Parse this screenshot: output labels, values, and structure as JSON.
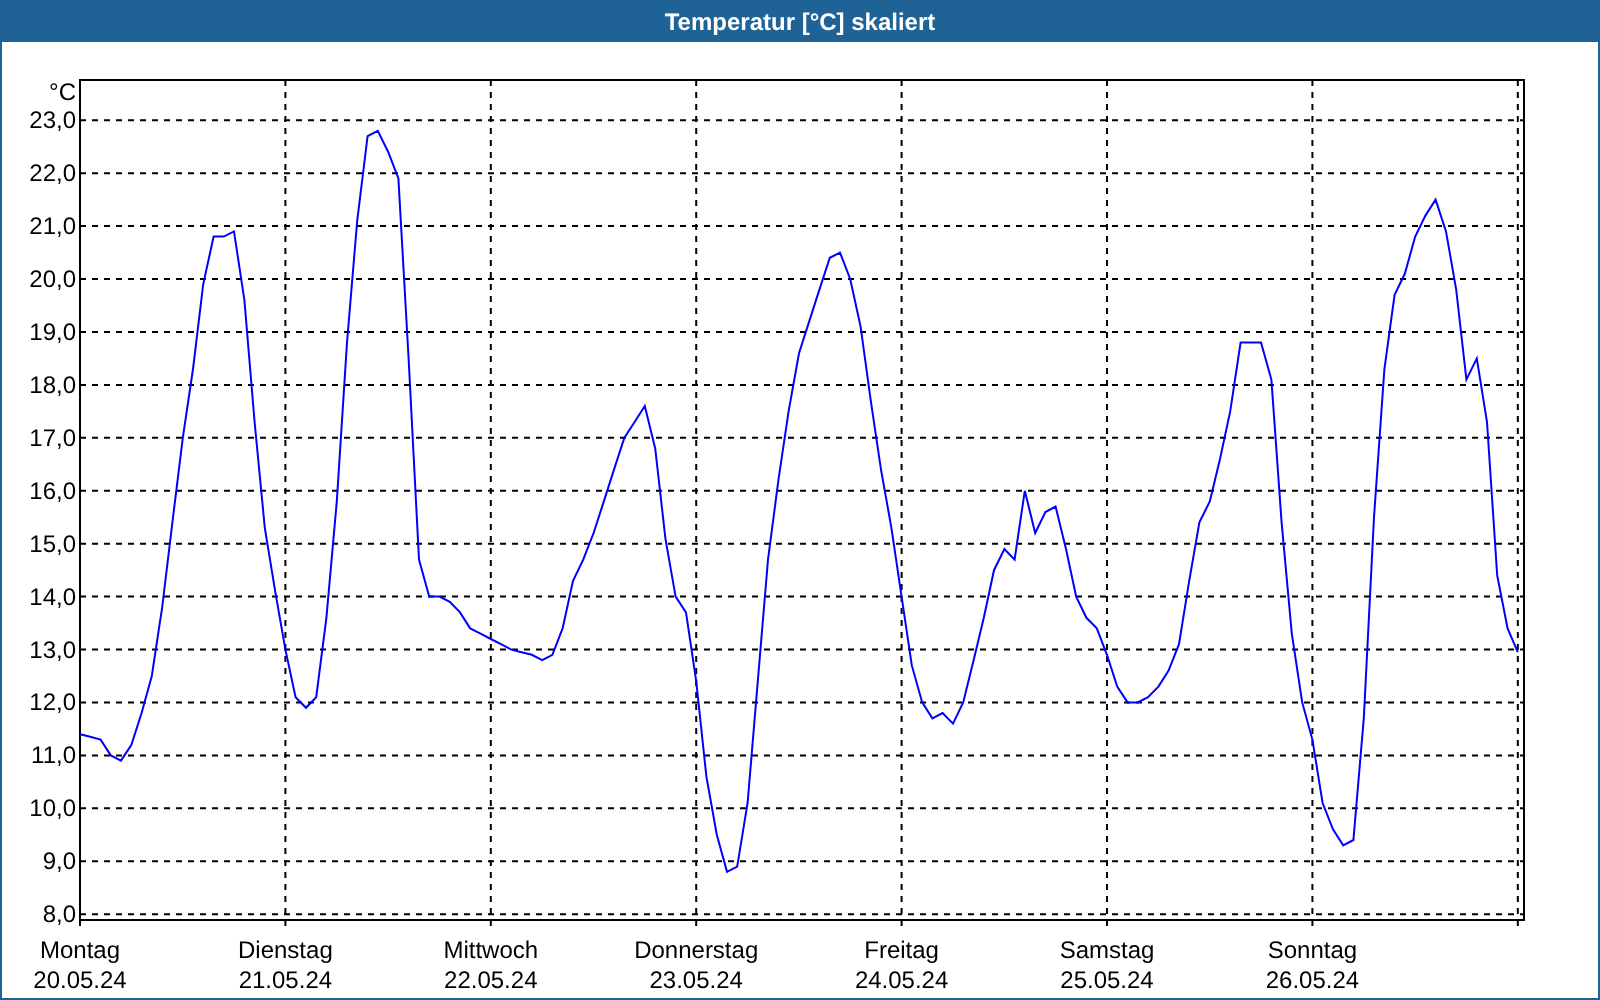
{
  "window": {
    "title": "Temperatur [°C] skaliert"
  },
  "chart": {
    "dates": [
      "20.05.24",
      "21.05.24",
      "22.05.24",
      "23.05.24",
      "24.05.24",
      "25.05.24",
      "26.05.24"
    ],
    "chart_data": {
      "type": "line",
      "grid": true,
      "ylabel": "°C",
      "ylim": [
        7.89,
        23.76
      ],
      "yticks": [
        {
          "value": 8,
          "label": "8,0"
        },
        {
          "value": 9,
          "label": "9,0"
        },
        {
          "value": 10,
          "label": "10,0"
        },
        {
          "value": 11,
          "label": "11,0"
        },
        {
          "value": 12,
          "label": "12,0"
        },
        {
          "value": 13,
          "label": "13,0"
        },
        {
          "value": 14,
          "label": "14,0"
        },
        {
          "value": 15,
          "label": "15,0"
        },
        {
          "value": 16,
          "label": "16,0"
        },
        {
          "value": 17,
          "label": "17,0"
        },
        {
          "value": 18,
          "label": "18,0"
        },
        {
          "value": 19,
          "label": "19,0"
        },
        {
          "value": 20,
          "label": "20,0"
        },
        {
          "value": 21,
          "label": "21,0"
        },
        {
          "value": 22,
          "label": "22,0"
        },
        {
          "value": 23,
          "label": "23,0"
        }
      ],
      "categories": [
        "Montag",
        null,
        null,
        null,
        null,
        null,
        null,
        null,
        null,
        null,
        null,
        null,
        null,
        null,
        null,
        null,
        null,
        null,
        null,
        null,
        "Dienstag",
        null,
        null,
        null,
        null,
        null,
        null,
        null,
        null,
        null,
        null,
        null,
        null,
        null,
        null,
        null,
        null,
        null,
        null,
        null,
        "Mittwoch",
        null,
        null,
        null,
        null,
        null,
        null,
        null,
        null,
        null,
        null,
        null,
        null,
        null,
        null,
        null,
        null,
        null,
        null,
        null,
        "Donnerstag",
        null,
        null,
        null,
        null,
        null,
        null,
        null,
        null,
        null,
        null,
        null,
        null,
        null,
        null,
        null,
        null,
        null,
        null,
        null,
        "Freitag",
        null,
        null,
        null,
        null,
        null,
        null,
        null,
        null,
        null,
        null,
        null,
        null,
        null,
        null,
        null,
        null,
        null,
        null,
        null,
        "Samstag",
        null,
        null,
        null,
        null,
        null,
        null,
        null,
        null,
        null,
        null,
        null,
        null,
        null,
        null,
        null,
        null,
        null,
        null,
        null,
        "Sonntag",
        null,
        null,
        null,
        null,
        null,
        null,
        null,
        null,
        null,
        null,
        null,
        null,
        null,
        null,
        null,
        null,
        null,
        null,
        null,
        null
      ],
      "series": [
        {
          "color": "#0000ff",
          "values": [
            11.4,
            11.35,
            11.3,
            11.0,
            10.9,
            11.2,
            11.8,
            12.5,
            13.8,
            15.4,
            17.0,
            18.3,
            19.9,
            20.8,
            20.8,
            20.9,
            19.6,
            17.3,
            15.3,
            14.1,
            13.0,
            12.1,
            11.9,
            12.1,
            13.6,
            15.8,
            18.8,
            21.1,
            22.7,
            22.8,
            22.4,
            21.9,
            18.5,
            14.7,
            14.0,
            14.0,
            13.9,
            13.7,
            13.4,
            13.3,
            13.2,
            13.1,
            13.0,
            12.95,
            12.9,
            12.8,
            12.9,
            13.4,
            14.3,
            14.7,
            15.2,
            15.8,
            16.4,
            17.0,
            17.3,
            17.6,
            16.8,
            15.1,
            14.0,
            13.7,
            12.4,
            10.6,
            9.5,
            8.8,
            8.9,
            10.1,
            12.4,
            14.7,
            16.2,
            17.5,
            18.6,
            19.2,
            19.8,
            20.4,
            20.5,
            20.0,
            19.1,
            17.7,
            16.4,
            15.3,
            14.0,
            12.7,
            12.0,
            11.7,
            11.8,
            11.6,
            12.0,
            12.8,
            13.6,
            14.5,
            14.9,
            14.7,
            16.0,
            15.2,
            15.6,
            15.7,
            14.9,
            14.0,
            13.6,
            13.4,
            12.9,
            12.3,
            12.0,
            12.0,
            12.1,
            12.3,
            12.6,
            13.1,
            14.3,
            15.4,
            15.8,
            16.6,
            17.5,
            18.8,
            18.8,
            18.8,
            18.1,
            15.4,
            13.3,
            12.0,
            11.3,
            10.1,
            9.6,
            9.3,
            9.4,
            11.7,
            15.5,
            18.3,
            19.7,
            20.1,
            20.8,
            21.2,
            21.5,
            20.9,
            19.8,
            18.1,
            18.5,
            17.3,
            14.4,
            13.4,
            12.95
          ]
        }
      ]
    }
  }
}
